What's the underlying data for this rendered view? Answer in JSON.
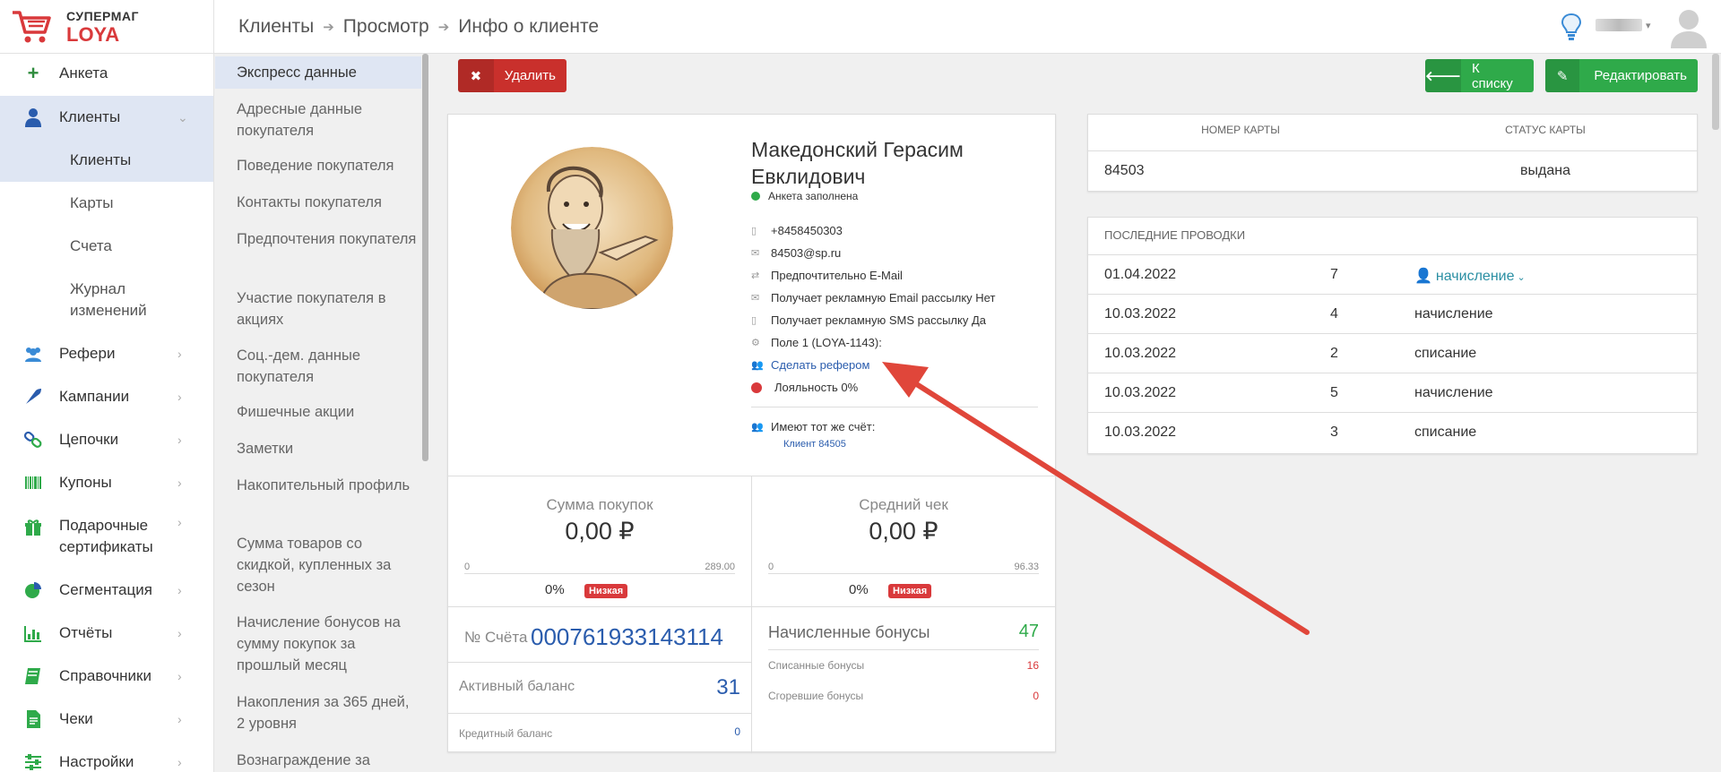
{
  "app": {
    "logo_line1": "СУПЕРМАГ",
    "logo_line2": "LOYA",
    "brand_color": "#d9393b"
  },
  "breadcrumb": [
    "Клиенты",
    "Просмотр",
    "Инфо о клиенте"
  ],
  "sidebar": {
    "items": [
      {
        "label": "Анкета",
        "icon": "plus-icon"
      },
      {
        "label": "Клиенты",
        "icon": "user-icon",
        "active": true
      },
      {
        "label": "Рефери",
        "icon": "users-icon"
      },
      {
        "label": "Кампании",
        "icon": "rocket-icon"
      },
      {
        "label": "Цепочки",
        "icon": "chain-icon"
      },
      {
        "label": "Купоны",
        "icon": "barcode-icon"
      },
      {
        "label": "Подарочные сертификаты",
        "icon": "gift-icon"
      },
      {
        "label": "Сегментация",
        "icon": "pie-icon"
      },
      {
        "label": "Отчёты",
        "icon": "bar-chart-icon"
      },
      {
        "label": "Справочники",
        "icon": "book-icon"
      },
      {
        "label": "Чеки",
        "icon": "receipt-icon"
      },
      {
        "label": "Настройки",
        "icon": "sliders-icon"
      }
    ],
    "subitems": [
      "Клиенты",
      "Карты",
      "Счета",
      "Журнал изменений"
    ]
  },
  "section_nav": [
    "Экспресс данные",
    "Адресные данные покупателя",
    "Поведение покупателя",
    "Контакты покупателя",
    "Предпочтения покупателя",
    "Участие покупателя в акциях",
    "Соц.-дем. данные покупателя",
    "Фишечные акции",
    "Заметки",
    "Накопительный профиль",
    "Сумма товаров со скидкой, купленных за сезон",
    "Начисление бонусов на сумму покупок за прошлый месяц",
    "Накопления за 365 дней, 2 уровня",
    "Вознаграждение за"
  ],
  "toolbar": {
    "delete_label": "Удалить",
    "list_label": "К списку",
    "edit_label": "Редактировать"
  },
  "client": {
    "name": "Македонский Герасим Евклидович",
    "status": "Анкета заполнена",
    "phone": "+8458450303",
    "email": "84503@sp.ru",
    "preferred": "Предпочтительно E-Mail",
    "email_promo": "Получает рекламную Email рассылку Нет",
    "sms_promo": "Получает рекламную SMS рассылку Да",
    "field1": "Поле 1 (LOYA-1143):",
    "make_referrer": "Сделать рефером",
    "loyalty": "Лояльность 0%",
    "same_account_label": "Имеют тот же счёт:",
    "same_account_link": "Клиент 84505"
  },
  "stats": {
    "purchases": {
      "title": "Сумма покупок",
      "value": "0,00 ₽",
      "min": "0",
      "max": "289.00",
      "pct": "0%",
      "badge": "Низкая"
    },
    "avg_check": {
      "title": "Средний чек",
      "value": "0,00 ₽",
      "min": "0",
      "max": "96.33",
      "pct": "0%",
      "badge": "Низкая"
    },
    "account_label": "№ Счёта",
    "account_number": "000761933143114",
    "active_balance_label": "Активный баланс",
    "active_balance": "31",
    "credit_balance_label": "Кредитный баланс",
    "credit_balance": "0",
    "accrued_label": "Начисленные бонусы",
    "accrued": "47",
    "spent_label": "Списанные бонусы",
    "spent": "16",
    "burned_label": "Сгоревшие бонусы",
    "burned": "0"
  },
  "cards": {
    "col1": "НОМЕР КАРТЫ",
    "col2": "СТАТУС КАРТЫ",
    "number": "84503",
    "status": "выдана"
  },
  "transactions": {
    "title": "ПОСЛЕДНИЕ ПРОВОДКИ",
    "rows": [
      {
        "date": "01.04.2022",
        "amount": "7",
        "type": "начисление"
      },
      {
        "date": "10.03.2022",
        "amount": "4",
        "type": "начисление"
      },
      {
        "date": "10.03.2022",
        "amount": "2",
        "type": "списание"
      },
      {
        "date": "10.03.2022",
        "amount": "5",
        "type": "начисление"
      },
      {
        "date": "10.03.2022",
        "amount": "3",
        "type": "списание"
      }
    ]
  }
}
